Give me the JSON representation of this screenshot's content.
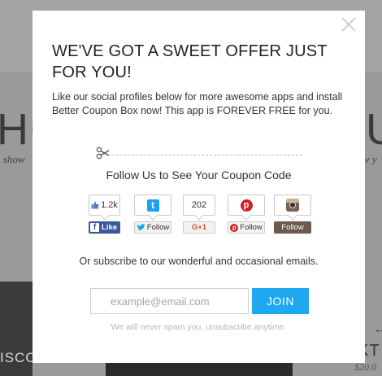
{
  "background": {
    "left_big_text": "HO",
    "right_big_text": "U",
    "left_small_text": "show",
    "right_small_text": "w y",
    "discount_text": "ISCOUNT",
    "arrow": "←",
    "kt_text": "KT",
    "price": "$20.0"
  },
  "modal": {
    "heading": "WE'VE GOT A SWEET OFFER JUST FOR YOU!",
    "intro": "Like our social profiles below for more awesome apps and install Better Coupon Box now! This app is FOREVER FREE for you.",
    "follow_title": "Follow Us to See Your Coupon Code",
    "subscribe_text": "Or subscribe to our wonderful and occasional emails.",
    "email_placeholder": "example@email.com",
    "email_value": "",
    "join_label": "JOIN",
    "spam_note": "We will never spam you, unsubscribe anytime."
  },
  "social": {
    "facebook": {
      "count": "1.2k",
      "label": "Like",
      "color": "#3b5998"
    },
    "twitter": {
      "label": "Follow",
      "color": "#1da1f2"
    },
    "googleplus": {
      "count": "202",
      "label": "G+1",
      "color": "#dd4b39"
    },
    "pinterest": {
      "label": "Follow",
      "color": "#cb2027"
    },
    "instagram": {
      "label": "Follow",
      "color": "#6d5a4f"
    }
  },
  "colors": {
    "accent": "#1ea8f0"
  }
}
